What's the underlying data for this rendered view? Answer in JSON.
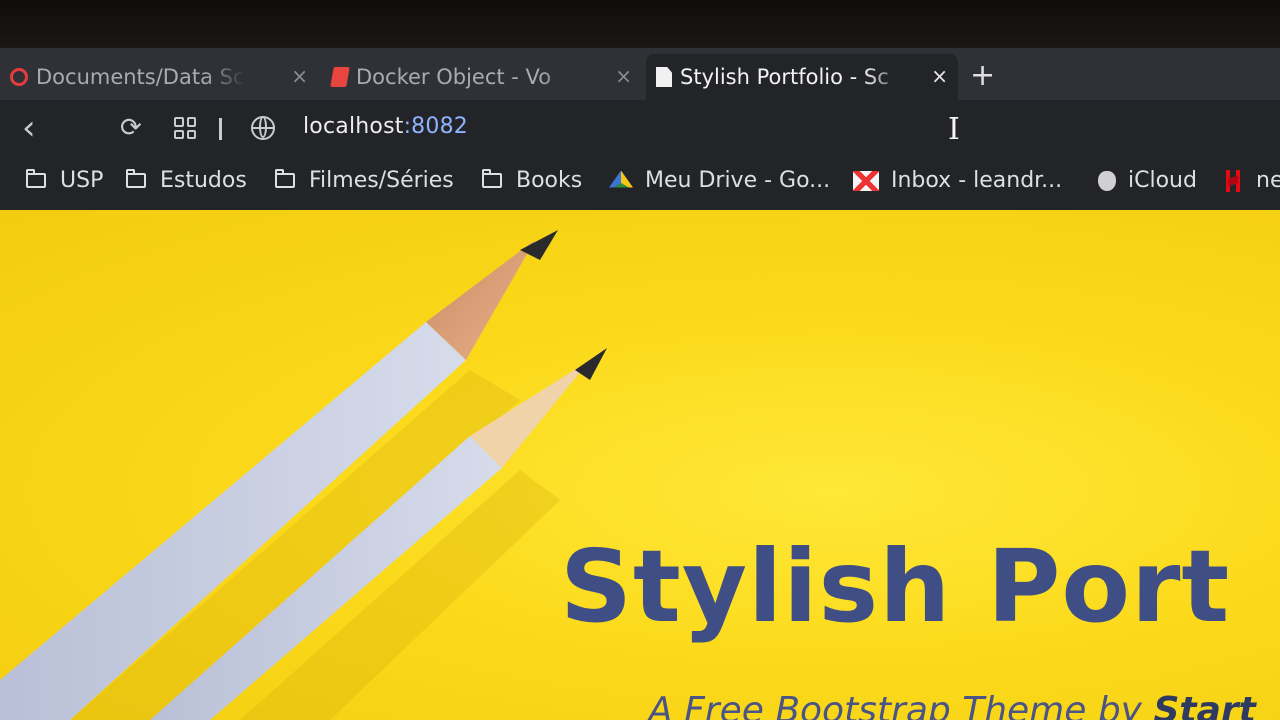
{
  "tabs": [
    {
      "title": "Documents/Data Sci",
      "favicon": "red-circle-icon",
      "active": false
    },
    {
      "title": "Docker Object - Vo",
      "favicon": "red-doc-icon",
      "active": false
    },
    {
      "title": "Stylish Portfolio - Sc",
      "favicon": "page-icon",
      "active": true
    }
  ],
  "tab_close": "×",
  "new_tab": "+",
  "toolbar": {
    "back": "‹",
    "reload": "⟳",
    "url_host": "localhost",
    "url_port": ":8082"
  },
  "bookmarks": [
    {
      "label": "USP",
      "icon": "folder-icon"
    },
    {
      "label": "Estudos",
      "icon": "folder-icon"
    },
    {
      "label": "Filmes/Séries",
      "icon": "folder-icon"
    },
    {
      "label": "Books",
      "icon": "folder-icon"
    },
    {
      "label": "Meu Drive - Go...",
      "icon": "google-drive-icon"
    },
    {
      "label": "Inbox - leandr...",
      "icon": "gmail-icon"
    },
    {
      "label": "iCloud",
      "icon": "apple-icon"
    },
    {
      "label": "ne",
      "icon": "netflix-icon"
    }
  ],
  "hero": {
    "title": "Stylish Port",
    "subtitle_prefix": "A Free Bootstrap Theme by ",
    "subtitle_brand": "Start",
    "background": "#fbd91a",
    "title_color": "#3f4f86"
  },
  "colors": {
    "tab_active": "#232428",
    "tabstrip": "#2f3136",
    "url_port": "#8fb4ff"
  }
}
